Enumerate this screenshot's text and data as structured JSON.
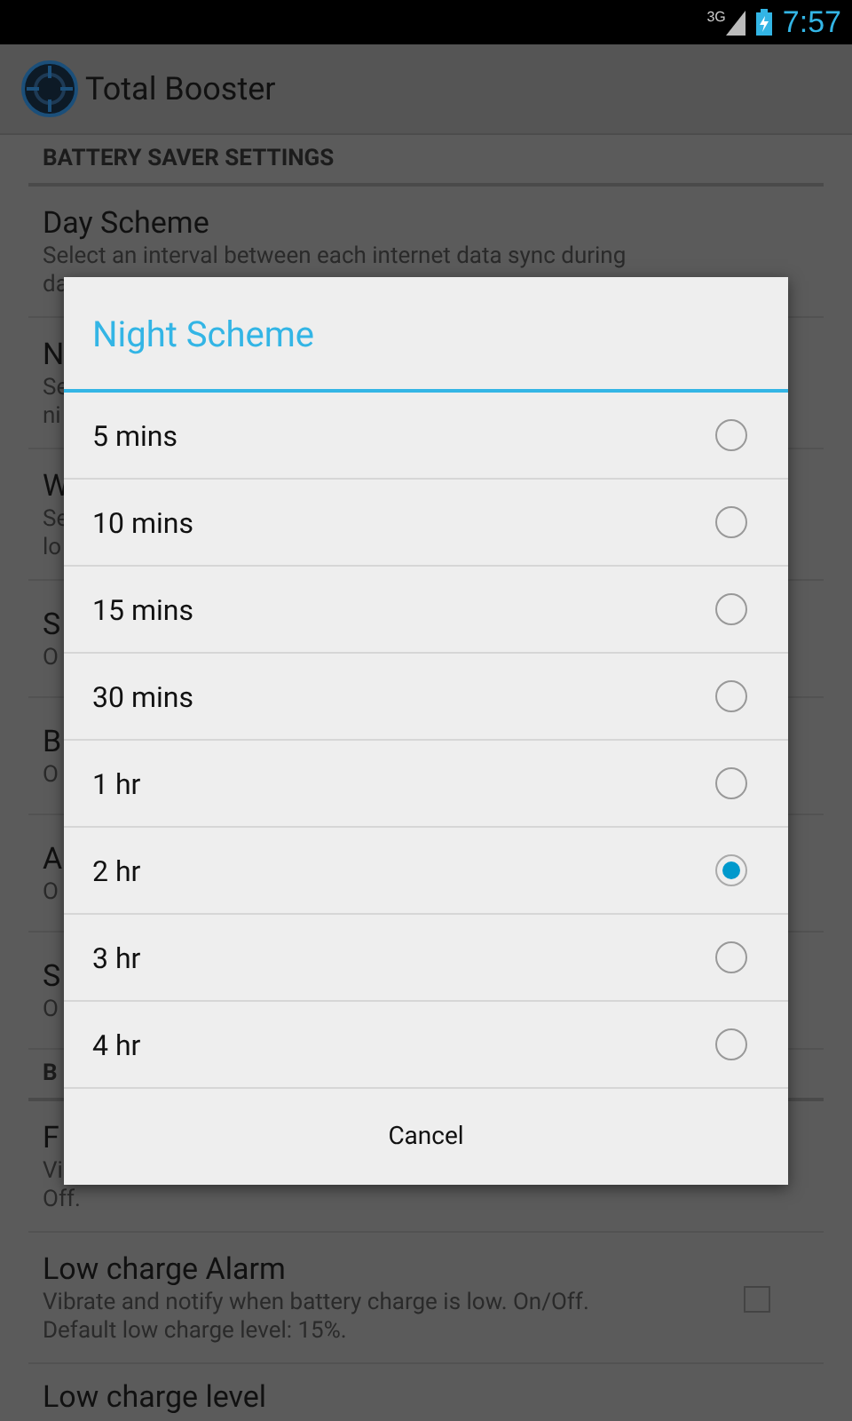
{
  "status_bar": {
    "network": "3G",
    "time": "7:57"
  },
  "action_bar": {
    "title": "Total Booster"
  },
  "settings": [
    {
      "header": "BATTERY SAVER SETTINGS",
      "items": [
        {
          "title": "Day Scheme",
          "lines": [
            "Select an interval between each internet data sync during",
            "da"
          ]
        },
        {
          "title": "N",
          "lines": [
            "Se",
            "ni"
          ]
        },
        {
          "title": "W",
          "lines": [
            "Se",
            "lo"
          ]
        },
        {
          "title": "S",
          "lines": [
            "O"
          ]
        },
        {
          "title": "B",
          "lines": [
            "O"
          ]
        },
        {
          "title": "A",
          "lines": [
            "O"
          ]
        },
        {
          "title": "S",
          "lines": [
            "O"
          ]
        }
      ]
    },
    {
      "header": "B",
      "items": [
        {
          "title": "F",
          "lines": [
            "Vi",
            "Off."
          ]
        },
        {
          "title": "Low charge Alarm",
          "lines": [
            "Vibrate and notify when battery charge is low. On/Off.",
            "Default low charge level: 15%."
          ],
          "checkbox": {
            "checked": false
          }
        },
        {
          "title": "Low charge level"
        }
      ]
    }
  ],
  "dialog": {
    "title": "Night Scheme",
    "options": [
      {
        "label": "5 mins",
        "selected": false
      },
      {
        "label": "10 mins",
        "selected": false
      },
      {
        "label": "15 mins",
        "selected": false
      },
      {
        "label": "30 mins",
        "selected": false
      },
      {
        "label": "1 hr",
        "selected": false
      },
      {
        "label": "2 hr",
        "selected": true
      },
      {
        "label": "3 hr",
        "selected": false
      },
      {
        "label": "4 hr",
        "selected": false
      }
    ],
    "button": "Cancel"
  }
}
